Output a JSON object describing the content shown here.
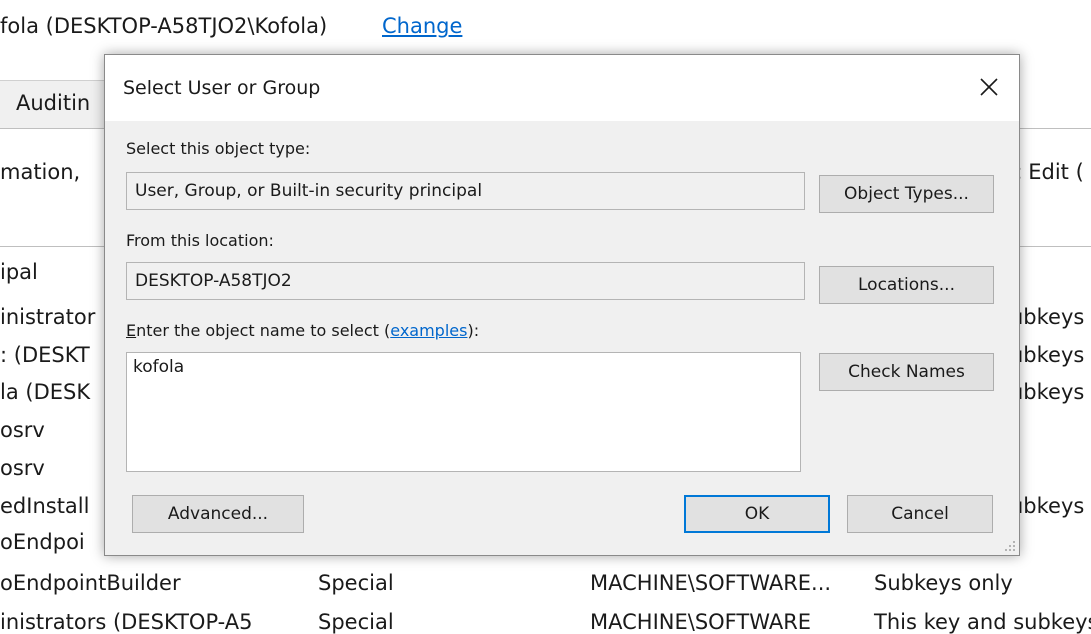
{
  "background": {
    "owner_text": "fola (DESKTOP-A58TJO2\\Kofola)",
    "owner_change_link": "Change",
    "tab_label": "Auditin",
    "column_left_header": "mation,",
    "column_right_header": "c Edit (",
    "left_rows": [
      "ipal",
      "inistrator",
      ": (DESKT",
      "la (DESK",
      "osrv",
      "osrv",
      "edInstall",
      "oEndpoi"
    ],
    "right_rows": [
      "ubkeys",
      "ubkeys",
      "ubkeys",
      "ubkeys"
    ],
    "bottom_rows": [
      {
        "principal": "oEndpointBuilder",
        "access": "Special",
        "inherited": "MACHINE\\SOFTWARE...",
        "applies": "Subkeys only"
      },
      {
        "principal": "inistrators (DESKTOP-A5",
        "access": "Special",
        "inherited": "MACHINE\\SOFTWARE",
        "applies": "This key and subkeys"
      }
    ]
  },
  "dialog": {
    "title": "Select User or Group",
    "object_type_label": "Select this object type:",
    "object_type_value": "User, Group, or Built-in security principal",
    "object_types_button": "Object Types...",
    "location_label": "From this location:",
    "location_value": "DESKTOP-A58TJO2",
    "locations_button": "Locations...",
    "name_label_accel": "E",
    "name_label_rest": "nter the object name to select (",
    "examples_link": "examples",
    "name_label_end": "):",
    "name_value": "kofola",
    "check_names_button": "Check Names",
    "advanced_button": "Advanced...",
    "ok_button": "OK",
    "cancel_button": "Cancel"
  }
}
